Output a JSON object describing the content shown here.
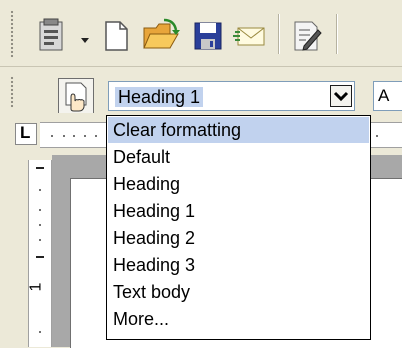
{
  "toolbar": {
    "icons": [
      "insert-fields-icon",
      "new-document-icon",
      "open-folder-icon",
      "save-icon",
      "email-icon",
      "edit-document-icon"
    ]
  },
  "style_selector": {
    "value": "Heading 1",
    "font_preview": "A"
  },
  "ruler": {
    "tab_marker": "L",
    "vertical_mark": "1"
  },
  "dropdown": {
    "items": [
      {
        "label": "Clear formatting",
        "highlighted": true
      },
      {
        "label": "Default"
      },
      {
        "label": "Heading"
      },
      {
        "label": "Heading 1"
      },
      {
        "label": "Heading 2"
      },
      {
        "label": "Heading 3"
      },
      {
        "label": "Text body"
      },
      {
        "label": "More..."
      }
    ]
  },
  "colors": {
    "toolbar_bg": "#ece9d8",
    "selection": "#c1d2ee",
    "border": "#7f9db9"
  }
}
